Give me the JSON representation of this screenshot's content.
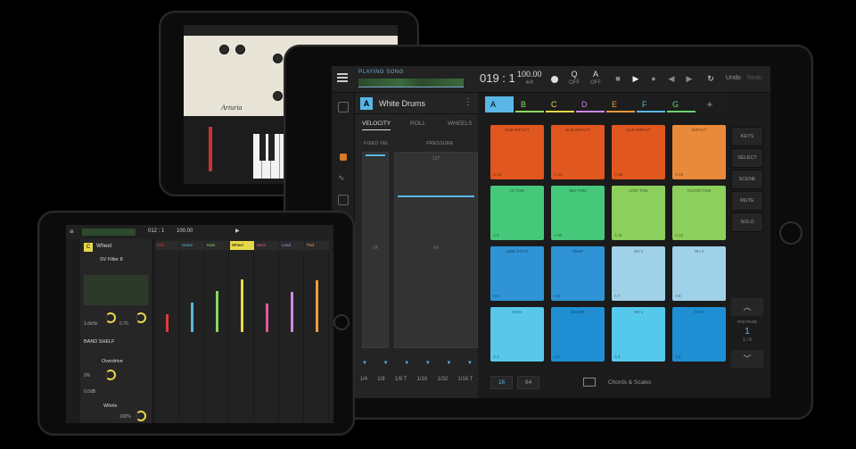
{
  "main": {
    "song": {
      "label": "PLAYING SONG"
    },
    "position": "019 : 1",
    "tempo": {
      "bpm": "100.00",
      "signature": "4/4"
    },
    "quantize": {
      "label": "Q",
      "state": "OFF"
    },
    "automation": {
      "label": "A",
      "state": "OFF"
    },
    "undo": "Undo",
    "redo": "Redo",
    "track": {
      "letter": "A",
      "name": "White Drums",
      "color": "#5ab6e6"
    },
    "mode_tabs": [
      "VELOCITY",
      "ROLL",
      "WHEELS"
    ],
    "fader_labels": [
      "FIXED VEL",
      "PRESSURE"
    ],
    "fader_texts": [
      "127",
      "64",
      "64"
    ],
    "divisions": [
      "1/4",
      "1/8",
      "1/8 T",
      "1/16",
      "1/32",
      "1/16 T"
    ],
    "scenes": [
      {
        "label": "A",
        "color": "#5ab6e6"
      },
      {
        "label": "B",
        "color": "#8ed65f"
      },
      {
        "label": "C",
        "color": "#e8d94a"
      },
      {
        "label": "D",
        "color": "#c78ae6"
      },
      {
        "label": "E",
        "color": "#f09a3a"
      },
      {
        "label": "F",
        "color": "#5ab6e6"
      },
      {
        "label": "G",
        "color": "#6fd06f"
      }
    ],
    "scene_add": "+",
    "pads": [
      {
        "name": "SUB IMPACT",
        "note": "A 13",
        "color": "#e0571f"
      },
      {
        "name": "SUB IMPACT",
        "note": "A 14",
        "color": "#e0571f"
      },
      {
        "name": "SUB IMPACT",
        "note": "A 15",
        "color": "#e0571f"
      },
      {
        "name": "IMPACT",
        "note": "A 16",
        "color": "#e98a3a"
      },
      {
        "name": "HI TOM",
        "note": "A 9",
        "color": "#46c87a"
      },
      {
        "name": "MID TOM",
        "note": "A 10",
        "color": "#46c87a"
      },
      {
        "name": "LOW TOM",
        "note": "A 11",
        "color": "#8ccf5c"
      },
      {
        "name": "FLOOR TOM",
        "note": "A 12",
        "color": "#8ccf5c"
      },
      {
        "name": "SIDE STICK",
        "note": "A 5",
        "color": "#2f93d6"
      },
      {
        "name": "SNAP",
        "note": "A 6",
        "color": "#2f93d6"
      },
      {
        "name": "OH 1",
        "note": "A 7",
        "color": "#9fd1e8"
      },
      {
        "name": "OH 2",
        "note": "A 8",
        "color": "#9fd1e8"
      },
      {
        "name": "KICK",
        "note": "A 1",
        "color": "#58c7ea"
      },
      {
        "name": "SNARE",
        "note": "A 2",
        "color": "#1f8fd4"
      },
      {
        "name": "HH 1",
        "note": "A 3",
        "color": "#55c9ec"
      },
      {
        "name": "HH 2",
        "note": "A 4",
        "color": "#1f8fd4"
      }
    ],
    "side_modes": [
      "KEYS",
      "SELECT",
      "SCENE",
      "MUTE",
      "SOLO"
    ],
    "page": {
      "label": "PAD PAGE",
      "number": "1",
      "of": "1 / 6"
    },
    "bottom": {
      "seg1": "16",
      "seg2": "64",
      "chords": "Chords & Scales"
    }
  },
  "top_left": {
    "logo": "Arturia"
  },
  "bottom_left": {
    "position": "012 : 1",
    "tempo": "100.00",
    "device": {
      "letter": "C",
      "name": "Wheel"
    },
    "sections": [
      "SV Filter 8",
      "BAND SHELF",
      "Overdrive",
      "Whirls"
    ],
    "values": [
      "1.6kHz",
      "0.70",
      "0.0dB",
      "0%",
      "100%"
    ],
    "channels": [
      {
        "name": "Kick",
        "color": "#e03a3a"
      },
      {
        "name": "Snare",
        "color": "#5ab6e6"
      },
      {
        "name": "Hats",
        "color": "#8ed65f"
      },
      {
        "name": "Wheel",
        "color": "#e8d94a"
      },
      {
        "name": "Bass",
        "color": "#e05a9a"
      },
      {
        "name": "Lead",
        "color": "#c78ae6"
      },
      {
        "name": "Pad",
        "color": "#f09a3a"
      }
    ]
  }
}
